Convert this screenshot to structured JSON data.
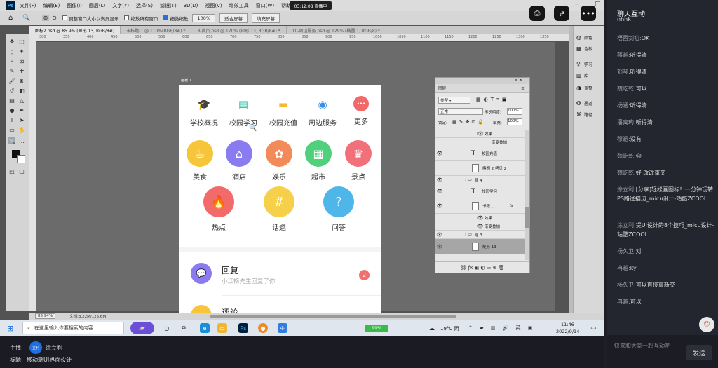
{
  "ps": {
    "logo": "Ps",
    "menu": [
      "文件(F)",
      "编辑(E)",
      "图像(I)",
      "图层(L)",
      "文字(Y)",
      "选择(S)",
      "滤镜(T)",
      "3D(D)",
      "视图(V)",
      "增效工具",
      "窗口(W)",
      "帮助(H)"
    ],
    "center_badge": "03:12:08 直播中",
    "options": {
      "resize_windows": "调整窗口大小以满屏显示",
      "zoom_all": "缩放所有窗口",
      "scrubby_zoom": "细微缩放",
      "zoom_value": "100%",
      "fit_screen": "适合屏幕",
      "fill_screen": "填充屏幕"
    },
    "tabs": [
      "图标2.psd @ 85.9% (矩形 13, RGB/8#)",
      "未标题-1 @ 110%(RGB/8#) *",
      "8-首页.psd @ 170% (矩形 13, RGB/8#) *",
      "10-周边服务.psd @ 129% (椭圆 1, RGB/8) *"
    ],
    "ruler_marks": [
      "300",
      "350",
      "400",
      "450",
      "500",
      "550",
      "600",
      "650",
      "700",
      "750",
      "800",
      "850",
      "900",
      "950",
      "1000",
      "1050",
      "1100",
      "1150",
      "1200",
      "1250",
      "1300",
      "1350"
    ],
    "artboard_label": "画板 1",
    "status_zoom": "85.94%",
    "status_doc": "文档:3.22M/125.6M",
    "side_panels": [
      "颜色",
      "色板",
      "学习",
      "库",
      "调整",
      "通道",
      "路径"
    ]
  },
  "app": {
    "top_items": [
      {
        "label": "学校概况",
        "icon": "graduation-cap-icon",
        "color": "#f5a623",
        "glyph": "🎓"
      },
      {
        "label": "校园学习",
        "icon": "document-icon",
        "color": "#2bbf9e",
        "glyph": "▤"
      },
      {
        "label": "校园充值",
        "icon": "card-icon",
        "color": "#f5b82e",
        "glyph": "▬"
      },
      {
        "label": "周边服务",
        "icon": "location-icon",
        "color": "#3a8ee6",
        "glyph": "◉"
      },
      {
        "label": "更多",
        "icon": "more-icon",
        "color": "#f06a6a",
        "glyph": "•••"
      }
    ],
    "cat_row1": [
      {
        "label": "美食",
        "icon": "cup-icon",
        "color": "#f7c53a",
        "glyph": "☕"
      },
      {
        "label": "酒店",
        "icon": "house-icon",
        "color": "#8a7cf0",
        "glyph": "⌂"
      },
      {
        "label": "娱乐",
        "icon": "film-icon",
        "color": "#f28a5a",
        "glyph": "✿"
      },
      {
        "label": "超市",
        "icon": "store-icon",
        "color": "#4fd07a",
        "glyph": "▦"
      },
      {
        "label": "景点",
        "icon": "crown-icon",
        "color": "#f2707a",
        "glyph": "♛"
      }
    ],
    "cat_row2": [
      {
        "label": "热点",
        "icon": "flame-icon",
        "color": "#f26a6a",
        "glyph": "🔥"
      },
      {
        "label": "话题",
        "icon": "hashtag-icon",
        "color": "#f6d04a",
        "glyph": "#"
      },
      {
        "label": "问答",
        "icon": "question-icon",
        "color": "#4fb6ea",
        "glyph": "?"
      }
    ],
    "list_reply": {
      "title": "回复",
      "sub": "小江榜先生回复了你",
      "badge": "2"
    },
    "list_comment": {
      "title": "评论"
    }
  },
  "layers": {
    "title": "图层",
    "filter": "类型",
    "blend": "正常",
    "opacity_label": "不透明度:",
    "opacity": "100%",
    "lock_label": "锁定:",
    "fill_label": "填充:",
    "fill": "100%",
    "rows": [
      {
        "kind": "sub",
        "name": "效果"
      },
      {
        "kind": "sub",
        "name": "渐变叠加"
      },
      {
        "kind": "text",
        "name": "校园充值"
      },
      {
        "kind": "img",
        "name": "椭圆 2 拷贝 2"
      },
      {
        "kind": "group",
        "name": "组 4"
      },
      {
        "kind": "text",
        "name": "校园学习"
      },
      {
        "kind": "img",
        "name": "书籍 (1)"
      },
      {
        "kind": "sub",
        "name": "效果"
      },
      {
        "kind": "sub",
        "name": "渐变叠加"
      },
      {
        "kind": "group",
        "name": "组 3"
      },
      {
        "kind": "img",
        "name": "矩形 13"
      }
    ]
  },
  "taskbar": {
    "search_placeholder": "在这里输入你要搜索的内容",
    "battery": "99%",
    "weather": "19°C 阴",
    "time": "11:46",
    "date": "2022/9/14"
  },
  "stream_info": {
    "host_label": "主播:",
    "host_name": "涂立利",
    "avatar_text": "立利",
    "title_label": "标题:",
    "title": "移动端UI界面设计"
  },
  "chat": {
    "title": "聊天互动",
    "messages": [
      {
        "nick": "",
        "text": "nhhk"
      },
      {
        "nick": "梧西剑初:",
        "text": "OK"
      },
      {
        "nick": "蒋越:",
        "text": "听得清"
      },
      {
        "nick": "刘琴:",
        "text": "听得清"
      },
      {
        "nick": "魏屹乾:",
        "text": "可以"
      },
      {
        "nick": "杨涵:",
        "text": "听得清"
      },
      {
        "nick": "潘寓珣:",
        "text": "听得清"
      },
      {
        "nick": "穆涵:",
        "text": "没有"
      },
      {
        "nick": "魏屹乾:",
        "text": "😐"
      },
      {
        "nick": "魏屹乾:",
        "text": "好 改改重交"
      },
      {
        "nick": "涂立利:",
        "text": "[分享]轻松画图标！一分钟玩转PS路径描边_micu设计-站酷ZCOOL"
      },
      {
        "nick": "涂立利:",
        "text": "提UI设计的8个技巧_micu设计-站酷ZCOOL"
      },
      {
        "nick": "杨久卫:",
        "text": "对"
      },
      {
        "nick": "冉越:",
        "text": "ky"
      },
      {
        "nick": "杨久卫:",
        "text": "可以直接重新交"
      },
      {
        "nick": "冉越:",
        "text": "可以"
      }
    ],
    "input_placeholder": "快来和大家一起互动吧",
    "send": "发送"
  }
}
